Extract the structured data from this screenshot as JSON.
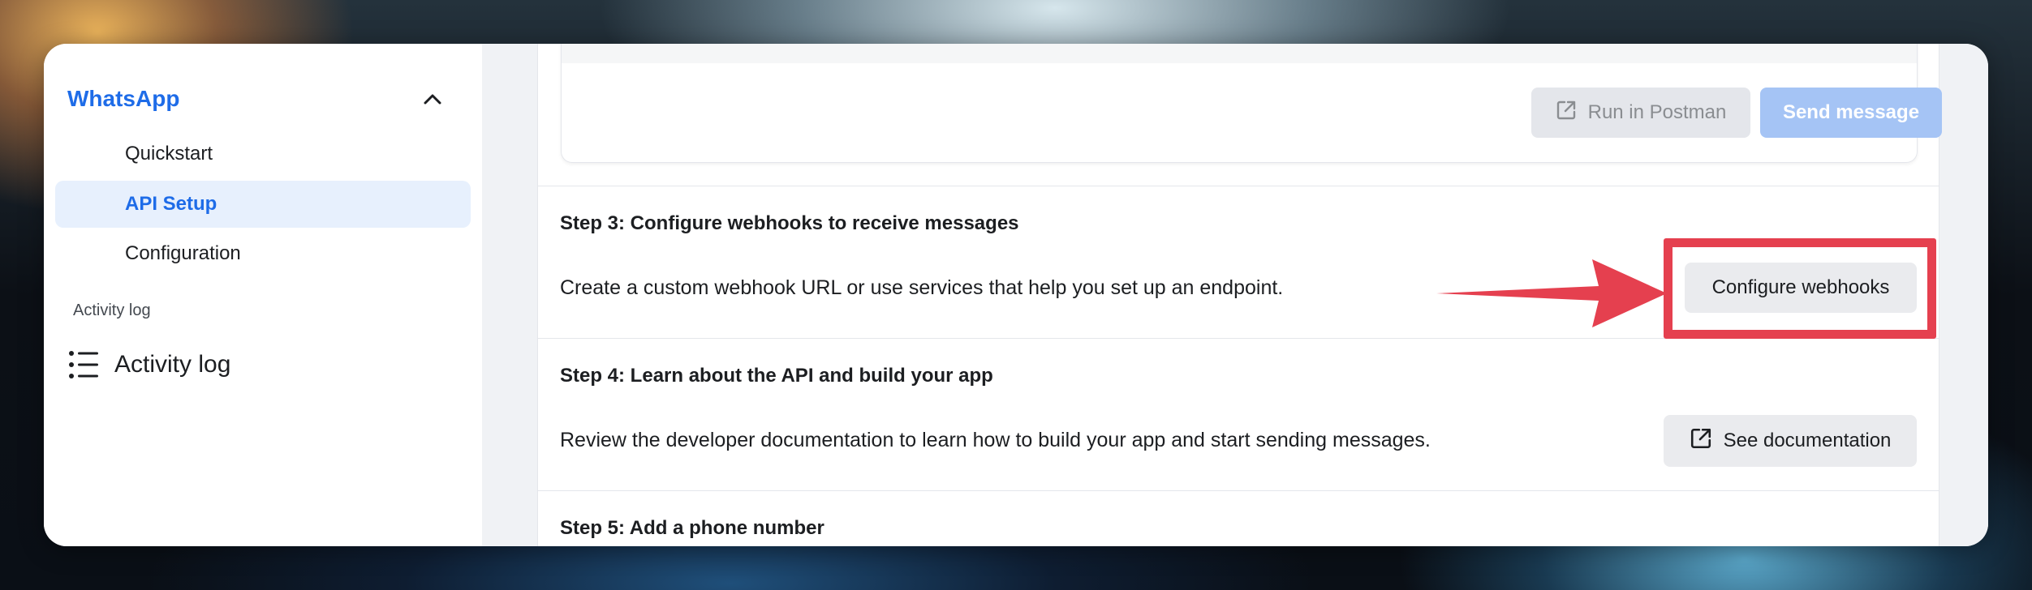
{
  "sidebar": {
    "title": "WhatsApp",
    "items": [
      {
        "label": "Quickstart",
        "active": false
      },
      {
        "label": "API Setup",
        "active": true
      },
      {
        "label": "Configuration",
        "active": false
      }
    ],
    "section_label": "Activity log",
    "activity_label": "Activity log"
  },
  "card": {
    "postman_label": "Run in Postman",
    "send_label": "Send message"
  },
  "steps": [
    {
      "title": "Step 3: Configure webhooks to receive messages",
      "description": "Create a custom webhook URL or use services that help you set up an endpoint.",
      "button": "Configure webhooks"
    },
    {
      "title": "Step 4: Learn about the API and build your app",
      "description": "Review the developer documentation to learn how to build your app and start sending messages.",
      "button": "See documentation"
    },
    {
      "title": "Step 5: Add a phone number"
    }
  ],
  "colors": {
    "accent": "#1e6ce8",
    "highlight": "#e5404f",
    "send_button_disabled": "#a5c4f5"
  },
  "icons": {
    "collapse": "chevron-up-icon",
    "activity": "list-icon",
    "external": "external-link-icon"
  }
}
